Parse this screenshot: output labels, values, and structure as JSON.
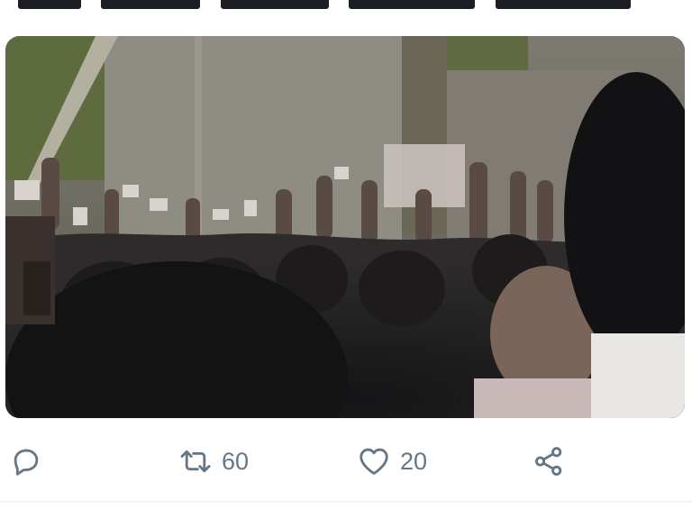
{
  "tweet": {
    "media": {
      "icon": "video-frame"
    },
    "actions": {
      "reply": {
        "icon": "reply-icon"
      },
      "retweet": {
        "icon": "retweet-icon",
        "count": "60"
      },
      "like": {
        "icon": "heart-icon",
        "count": "20"
      },
      "share": {
        "icon": "share-icon"
      }
    }
  },
  "colors": {
    "icon": "#657786",
    "divider": "#e6ecf0"
  }
}
